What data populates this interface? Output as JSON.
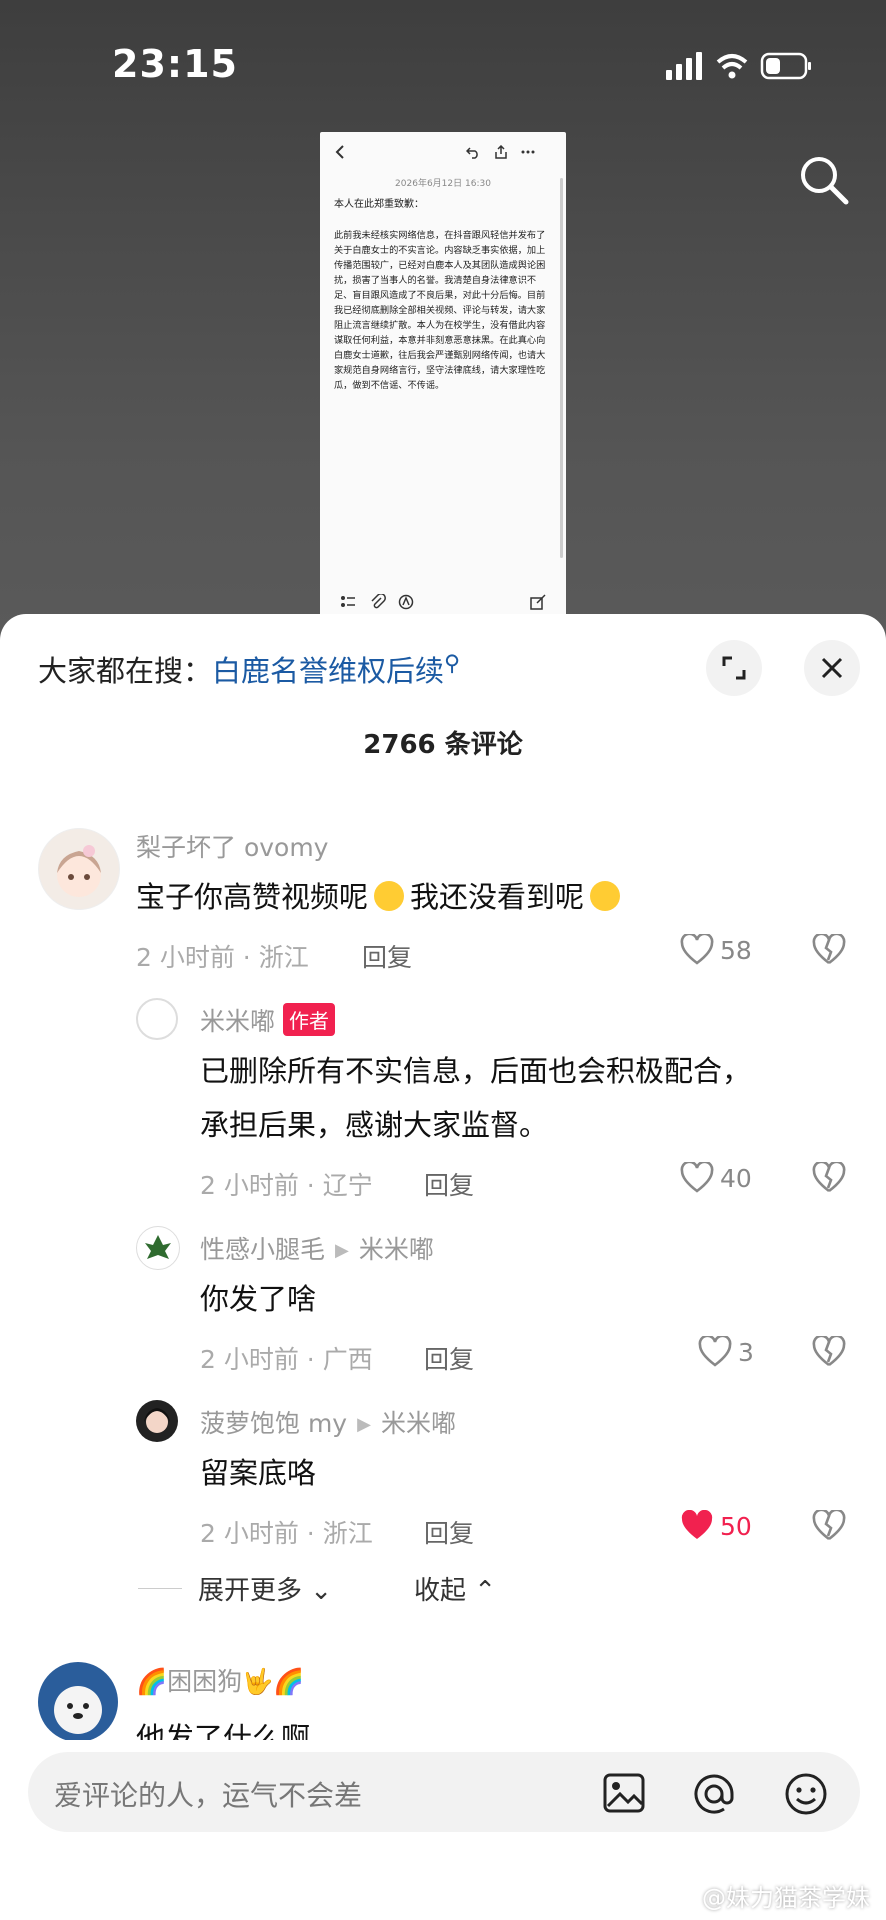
{
  "status_bar": {
    "time": "23:15"
  },
  "note": {
    "date": "2026年6月12日 16:30",
    "greeting": "本人在此郑重致歉：",
    "body": "此前我未经核实网络信息，在抖音跟风轻信并发布了关于白鹿女士的不实言论。内容缺乏事实依据，加上传播范围较广，已经对白鹿本人及其团队造成舆论困扰，损害了当事人的名誉。我清楚自身法律意识不足、盲目跟风造成了不良后果，对此十分后悔。目前我已经彻底删除全部相关视频、评论与转发，请大家阻止流言继续扩散。本人为在校学生，没有借此内容谋取任何利益，本意并非刻意恶意抹黑。在此真心向白鹿女士道歉，往后我会严谨甄别网络传闻，也请大家规范自身网络言行，坚守法律底线，请大家理性吃瓜，做到不信谣、不传谣。"
  },
  "search_hint": {
    "label": "大家都在搜：",
    "term": "白鹿名誉维权后续"
  },
  "comment_count": "2766 条评论",
  "comments": [
    {
      "user": "梨子坏了 ovomy",
      "text": "宝子你高赞视频呢",
      "text2": "我还没看到呢",
      "time_loc": "2 小时前 · 浙江",
      "reply": "回复",
      "likes": "58"
    }
  ],
  "replies": [
    {
      "user": "米米嘟",
      "badge": "作者",
      "text_line1": "已删除所有不实信息，后面也会积极配合，",
      "text_line2": "承担后果，感谢大家监督。",
      "time_loc": "2 小时前 · 辽宁",
      "reply": "回复",
      "likes": "40"
    },
    {
      "user": "性感小腿毛",
      "reply_to": "米米嘟",
      "text": "你发了啥",
      "time_loc": "2 小时前 · 广西",
      "reply": "回复",
      "likes": "3"
    },
    {
      "user": "菠萝饱饱 my",
      "reply_to": "米米嘟",
      "text": "留案底咯",
      "time_loc": "2 小时前 · 浙江",
      "reply": "回复",
      "likes": "50"
    }
  ],
  "expand": {
    "more": "展开更多",
    "collapse": "收起"
  },
  "next_comment": {
    "user": "困困狗",
    "text": "他发了什么啊"
  },
  "input": {
    "placeholder": "爱评论的人，运气不会差"
  },
  "watermark": "@妹力猫茶学妹",
  "colors": {
    "link": "#1b5aa3",
    "badge": "#f1214f",
    "liked": "#f1214f"
  }
}
